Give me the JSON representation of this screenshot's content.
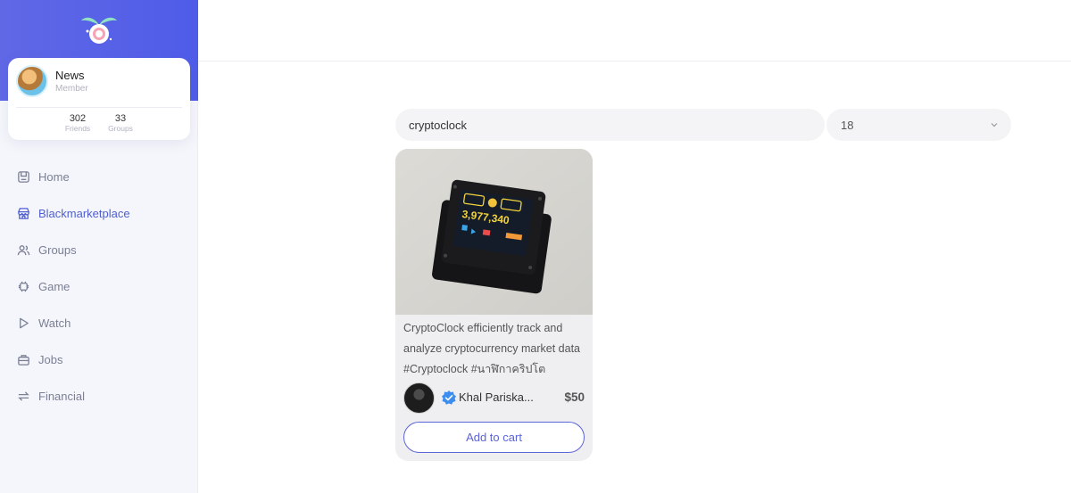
{
  "profile": {
    "name": "News",
    "role": "Member",
    "friends_count": "302",
    "friends_label": "Friends",
    "groups_count": "33",
    "groups_label": "Groups"
  },
  "nav": {
    "items": [
      {
        "label": "Home",
        "icon": "home-icon"
      },
      {
        "label": "Blackmarketplace",
        "icon": "store-icon",
        "active": true
      },
      {
        "label": "Groups",
        "icon": "users-icon"
      },
      {
        "label": "Game",
        "icon": "gamepad-icon"
      },
      {
        "label": "Watch",
        "icon": "play-icon"
      },
      {
        "label": "Jobs",
        "icon": "briefcase-icon"
      },
      {
        "label": "Financial",
        "icon": "exchange-icon"
      }
    ]
  },
  "search": {
    "value": "cryptoclock"
  },
  "filter": {
    "selected": "18"
  },
  "product": {
    "description": "CryptoClock efficiently track and analyze cryptocurrency market data #Cryptoclock #นาฬิกาคริปโต",
    "seller_name": "Khal Pariska...",
    "price": "$50",
    "cart_label": "Add to cart",
    "screen_value": "3,977,340"
  },
  "colors": {
    "accent": "#4f5fd3",
    "banner": "#5a63e6",
    "verified": "#3b8ef0"
  }
}
